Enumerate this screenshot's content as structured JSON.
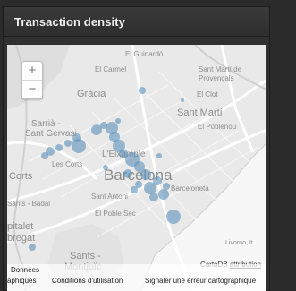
{
  "panel": {
    "title": "Transaction density"
  },
  "map": {
    "zoom_in_label": "+",
    "zoom_out_label": "−",
    "labels": {
      "guinardo": "El Guinardó",
      "carmel": "El Carmel",
      "sant_marti_provencals": "Sant Martí de",
      "provencals": "Provençals",
      "gracia": "Gràcia",
      "clot": "El Clot",
      "sant_marti": "Sant Martí",
      "sarria": "Sarrià -",
      "sant_gervasi": "Sant Gervasi",
      "poblenou": "El Poblenou",
      "eixample": "L'Eixample",
      "les_corts": "Les Corts",
      "corts": "Corts",
      "barcelona": "Barcelona",
      "barceloneta": "Barceloneta",
      "sants_badal": "Sants - Badal",
      "sant_antoni": "Sant Antoni",
      "poble_sec": "El Poble Sec",
      "pitalet": "pitalet",
      "bregat": "bregat",
      "sants_montjuic_1": "Sants -",
      "sants_montjuic_2": "Montjuïc",
      "livorno": "Livorno, It"
    },
    "attribution_text": "CartoDB",
    "attribution_link": "attribution",
    "footer": {
      "donnees_1": "Données",
      "donnees_2": "aphiques",
      "conditions": "Conditions d'utilisation",
      "signaler": "Signaler une erreur cartographique"
    },
    "bubble_color": "#5b8fb9"
  }
}
